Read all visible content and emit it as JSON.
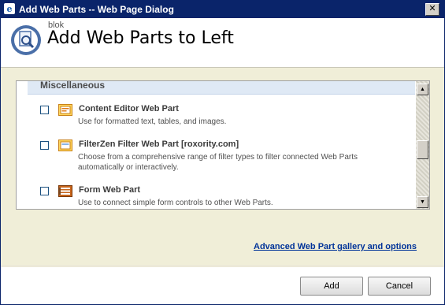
{
  "window": {
    "title": "Add Web Parts -- Web Page Dialog",
    "close_glyph": "✕"
  },
  "header": {
    "site_name": "blok",
    "title": "Add Web Parts to Left"
  },
  "gallery": {
    "category": "Miscellaneous",
    "items": [
      {
        "name": "Content Editor Web Part",
        "description": "Use for formatted text, tables, and images.",
        "checked": false,
        "icon": "content-editor-icon"
      },
      {
        "name": "FilterZen Filter Web Part [roxority.com]",
        "description": "Choose from a comprehensive range of filter types to filter connected Web Parts automatically or interactively.",
        "checked": false,
        "icon": "filter-webpart-icon"
      },
      {
        "name": "Form Web Part",
        "description": "Use to connect simple form controls to other Web Parts.",
        "checked": false,
        "icon": "form-webpart-icon"
      }
    ],
    "scroll_up_glyph": "▲",
    "scroll_down_glyph": "▼"
  },
  "links": {
    "advanced": "Advanced Web Part gallery and options"
  },
  "buttons": {
    "add": "Add",
    "cancel": "Cancel"
  },
  "colors": {
    "titlebar": "#0a246a",
    "content_bg": "#f0eed8",
    "category_bg": "#dfe9f5",
    "link": "#003399"
  }
}
